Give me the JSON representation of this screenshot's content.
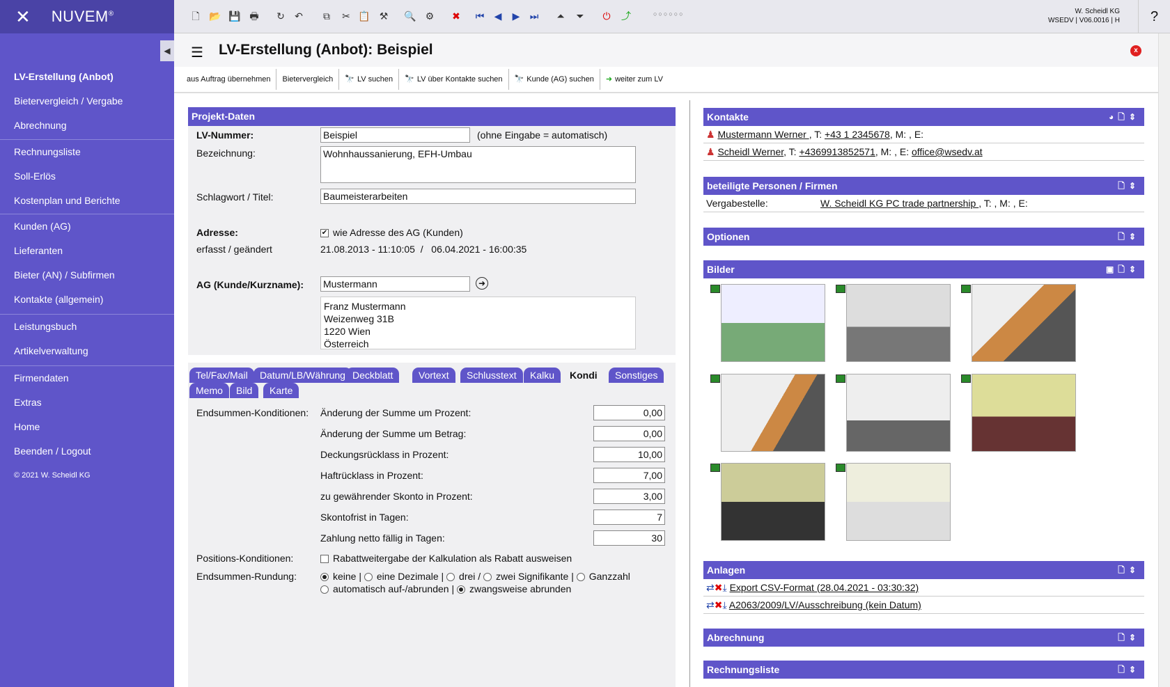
{
  "app": {
    "name": "NUVEM",
    "reg": "®",
    "company": "W. Scheidl KG",
    "version": "WSEDV | V06.0016 | H",
    "help": "?"
  },
  "sidebar": {
    "items": [
      "LV-Erstellung (Anbot)",
      "Bietervergleich / Vergabe",
      "Abrechnung",
      "Rechnungsliste",
      "Soll-Erlös",
      "Kostenplan und Berichte",
      "Kunden (AG)",
      "Lieferanten",
      "Bieter (AN) / Subfirmen",
      "Kontakte (allgemein)",
      "Leistungsbuch",
      "Artikelverwaltung",
      "Firmendaten",
      "Extras",
      "Home",
      "Beenden / Logout"
    ],
    "copyright": "© 2021 W. Scheidl KG"
  },
  "header": {
    "title": "LV-Erstellung (Anbot): Beispiel",
    "close": "x"
  },
  "actions": [
    "aus Auftrag übernehmen",
    "Bietervergleich",
    "LV suchen",
    "LV über Kontakte suchen",
    "Kunde (AG) suchen",
    "weiter zum LV"
  ],
  "projekt": {
    "title": "Projekt-Daten",
    "lv_label": "LV-Nummer:",
    "lv_value": "Beispiel",
    "lv_hint": "(ohne Eingabe = automatisch)",
    "bez_label": "Bezeichnung:",
    "bez_value": "Wohnhaussanierung, EFH-Umbau",
    "schlag_label": "Schlagwort / Titel:",
    "schlag_value": "Baumeisterarbeiten",
    "adr_label": "Adresse:",
    "adr_check": "wie Adresse des AG (Kunden)",
    "erfasst_label": "erfasst / geändert",
    "erfasst_value": "21.08.2013 - 11:10:05  /   06.04.2021 - 16:00:35",
    "ag_label": "AG (Kunde/Kurzname):",
    "ag_value": "Mustermann",
    "addr": [
      "Franz Mustermann",
      "Weizenweg 31B",
      "1220 Wien",
      "Österreich"
    ]
  },
  "tabs": [
    "Tel/Fax/Mail",
    "Datum/LB/Währung",
    "Deckblatt",
    "Vortext",
    "Schlusstext",
    "Kalku",
    "Kondi",
    "Sonstiges",
    "Memo",
    "Bild",
    "Karte"
  ],
  "kondi": {
    "end_label": "Endsummen-Konditionen:",
    "rows": [
      {
        "l": "Änderung der Summe um Prozent:",
        "v": "0,00"
      },
      {
        "l": "Änderung der Summe um Betrag:",
        "v": "0,00"
      },
      {
        "l": "Deckungsrücklass in Prozent:",
        "v": "10,00"
      },
      {
        "l": "Haftrücklass in Prozent:",
        "v": "7,00"
      },
      {
        "l": "zu gewährender Skonto in Prozent:",
        "v": "3,00"
      },
      {
        "l": "Skontofrist in Tagen:",
        "v": "7"
      },
      {
        "l": "Zahlung netto fällig in Tagen:",
        "v": "30"
      }
    ],
    "pos_label": "Positions-Konditionen:",
    "pos_check": "Rabattweitergabe der Kalkulation als Rabatt ausweisen",
    "rund_label": "Endsummen-Rundung:",
    "r1": "keine |",
    "r2": "eine Dezimale |",
    "r3": "drei /",
    "r4": "zwei Signifikante |",
    "r5": "Ganzzahl",
    "r6": "automatisch auf-/abrunden |",
    "r7": "zwangsweise abrunden"
  },
  "kontakte": {
    "title": "Kontakte",
    "c1_name": "Mustermann Werner ",
    "c1_t": ", T: ",
    "c1_tel": "+43 1 2345678",
    "c1_rest": ", M: , E:",
    "c2_name": "Scheidl Werner",
    "c2_t": ", T: ",
    "c2_tel": "+4369913852571",
    "c2_rest": ", M: , E: ",
    "c2_mail": "office@wsedv.at"
  },
  "beteiligte": {
    "title": "beteiligte Personen / Firmen",
    "label": "Vergabestelle:",
    "name": "W. Scheidl KG PC trade partnership ",
    "rest": ", T: , M: , E:"
  },
  "optionen": {
    "title": "Optionen"
  },
  "bilder": {
    "title": "Bilder"
  },
  "anlagen": {
    "title": "Anlagen",
    "a1": "Export CSV-Format (28.04.2021 - 03:30:32)",
    "a2": "A2063/2009/LV/Ausschreibung (kein Datum)"
  },
  "abrechnung": {
    "title": "Abrechnung"
  },
  "rechnungsliste": {
    "title": "Rechnungsliste"
  }
}
